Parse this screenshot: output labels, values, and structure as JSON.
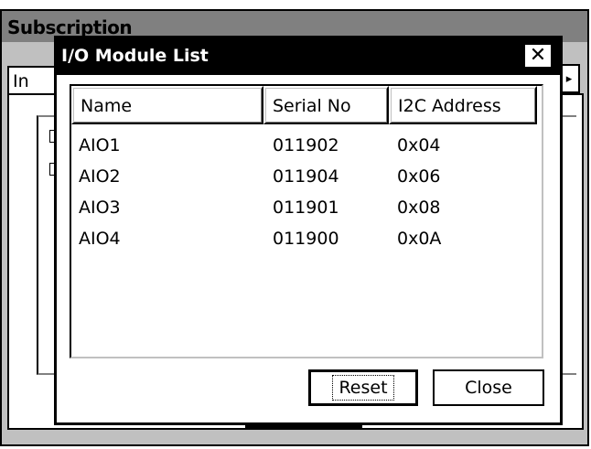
{
  "background_window": {
    "title": "Subscription",
    "tab_label": "In",
    "tab_arrow": "▸"
  },
  "dialog": {
    "title": "I/O Module List",
    "close_glyph": "✕",
    "columns": [
      "Name",
      "Serial No",
      "I2C Address"
    ],
    "rows": [
      {
        "name": "AIO1",
        "serial": "011902",
        "address": "0x04"
      },
      {
        "name": "AIO2",
        "serial": "011904",
        "address": "0x06"
      },
      {
        "name": "AIO3",
        "serial": "011901",
        "address": "0x08"
      },
      {
        "name": "AIO4",
        "serial": "011900",
        "address": "0x0A"
      }
    ],
    "buttons": {
      "reset": "Reset",
      "close": "Close"
    }
  }
}
